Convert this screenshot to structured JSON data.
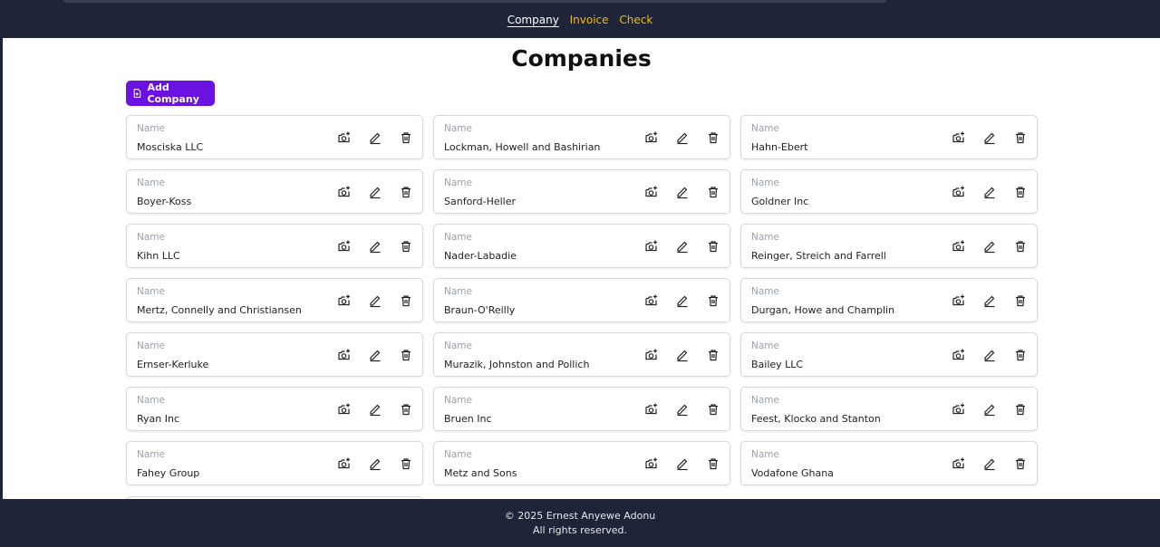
{
  "nav": {
    "items": [
      {
        "label": "Company",
        "active": true
      },
      {
        "label": "Invoice",
        "active": false
      },
      {
        "label": "Check",
        "active": false
      }
    ],
    "link_color": "#f5b700"
  },
  "page": {
    "title": "Companies",
    "add_button_label": "Add Company",
    "accent_color": "#6b11e0"
  },
  "field_label": "Name",
  "companies": [
    "Mosciska LLC",
    "Lockman, Howell and Bashirian",
    "Hahn-Ebert",
    "Boyer-Koss",
    "Sanford-Heller",
    "Goldner Inc",
    "Kihn LLC",
    "Nader-Labadie",
    "Reinger, Streich and Farrell",
    "Mertz, Connelly and Christiansen",
    "Braun-O'Reilly",
    "Durgan, Howe and Champlin",
    "Ernser-Kerluke",
    "Murazik, Johnston and Pollich",
    "Bailey LLC",
    "Ryan Inc",
    "Bruen Inc",
    "Feest, Klocko and Stanton",
    "Fahey Group",
    "Metz and Sons",
    "Vodafone Ghana"
  ],
  "card_icons": [
    "add-photo-icon",
    "edit-icon",
    "trash-icon"
  ],
  "footer": {
    "copyright": "© 2025 Ernest Anyewe Adonu",
    "rights": "All rights reserved."
  }
}
